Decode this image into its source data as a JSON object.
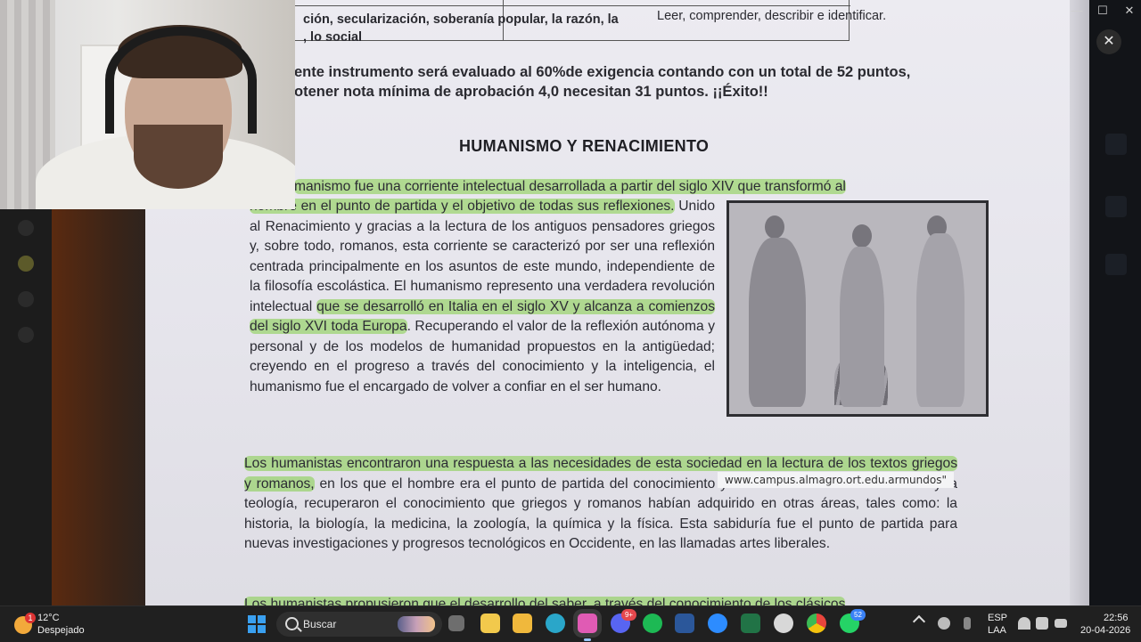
{
  "document": {
    "table_cell_left_line1": "ción, secularización, soberanía popular, la razón, la",
    "table_cell_left_line2": ", lo social",
    "table_cell_right": "Leer, comprender, describir e identificar.",
    "score_line1": "ente instrumento será evaluado al 60%de exigencia contando con un total de 52 puntos,",
    "score_line2": "otener nota mínima de aprobación 4,0 necesitan 31 puntos. ¡¡Éxito!!",
    "title": "HUMANISMO Y RENACIMIENTO",
    "p1_first_line": "manismo fue una corriente intelectual desarrollada a partir del siglo XIV que transformó al",
    "p1_hl_a": "hombre en el punto de partida y el objetivo de todas sus reflexiones.",
    "p1_text_a": " Unido al Renacimiento y gracias a la lectura de los antiguos pensadores griegos y, sobre todo, romanos, esta corriente se caracterizó por ser una reflexión centrada principalmente en los asuntos de este mundo, independiente de la filosofía escolástica. El humanismo represento una verdadera revolución intelectual ",
    "p1_hl_b": "que se desarrolló en Italia en el siglo XV y alcanza a comienzos del siglo XVI toda Europa",
    "p1_text_b": ". Recuperando el valor de la reflexión autónoma y personal y de los modelos de humanidad propuestos en la antigüedad; creyendo en el progreso a través del conocimiento y la inteligencia, el humanismo fue el encargado de volver a confiar en el ser humano.",
    "p2_hl": "Los humanistas encontraron una respuesta a las necesidades de esta sociedad en la lectura de los textos griegos y romanos,",
    "p2_text": " en los que el hombre era el punto de partida del conocimiento y del arte. Además de la filosofía y la teología, recuperaron el conocimiento que griegos y romanos habían adquirido en otras áreas, tales como: la historia, la biología, la medicina, la zoología, la química y la física. Esta sabiduría fue el punto de partida para nuevas investigaciones y progresos tecnológicos en Occidente, en las llamadas artes liberales.",
    "p3_hl": "Los humanistas propusieron que el desarrollo del saber, a través del conocimiento de los clásicos",
    "url_tooltip": "www.campus.almagro.ort.edu.armundos\""
  },
  "window": {
    "minimize": "—",
    "maximize": "☐",
    "close": "✕",
    "overlay_close": "✕"
  },
  "taskbar": {
    "weather_temp": "12°C",
    "weather_cond": "Despejado",
    "weather_badge": "1",
    "search_label": "Buscar",
    "discord_badge": "9+",
    "whatsapp_badge": "52",
    "lang1": "ESP",
    "lang2": "LAA",
    "time": "22:56",
    "date": "20-04-2026",
    "colors": {
      "accent_blue": "#3aa0f0",
      "highlight_green": "#82cd46"
    },
    "apps": [
      {
        "name": "task-view-icon",
        "color": "#9a9a9a"
      },
      {
        "name": "file-explorer-icon",
        "color": "#f2c94c"
      },
      {
        "name": "store-icon",
        "color": "#f2c94c"
      },
      {
        "name": "edge-icon",
        "color": "#2aa6c9"
      },
      {
        "name": "copilot-icon",
        "color": "#e05bb4"
      },
      {
        "name": "discord-icon",
        "color": "#5865f2"
      },
      {
        "name": "spotify-icon",
        "color": "#1db954"
      },
      {
        "name": "word-icon",
        "color": "#2b579a"
      },
      {
        "name": "zoom-icon",
        "color": "#2d8cff"
      },
      {
        "name": "excel-icon",
        "color": "#217346"
      },
      {
        "name": "chatgpt-icon",
        "color": "#d8d8d8"
      },
      {
        "name": "chrome-icon",
        "color": "#e8453c"
      },
      {
        "name": "whatsapp-icon",
        "color": "#25d366"
      }
    ]
  }
}
